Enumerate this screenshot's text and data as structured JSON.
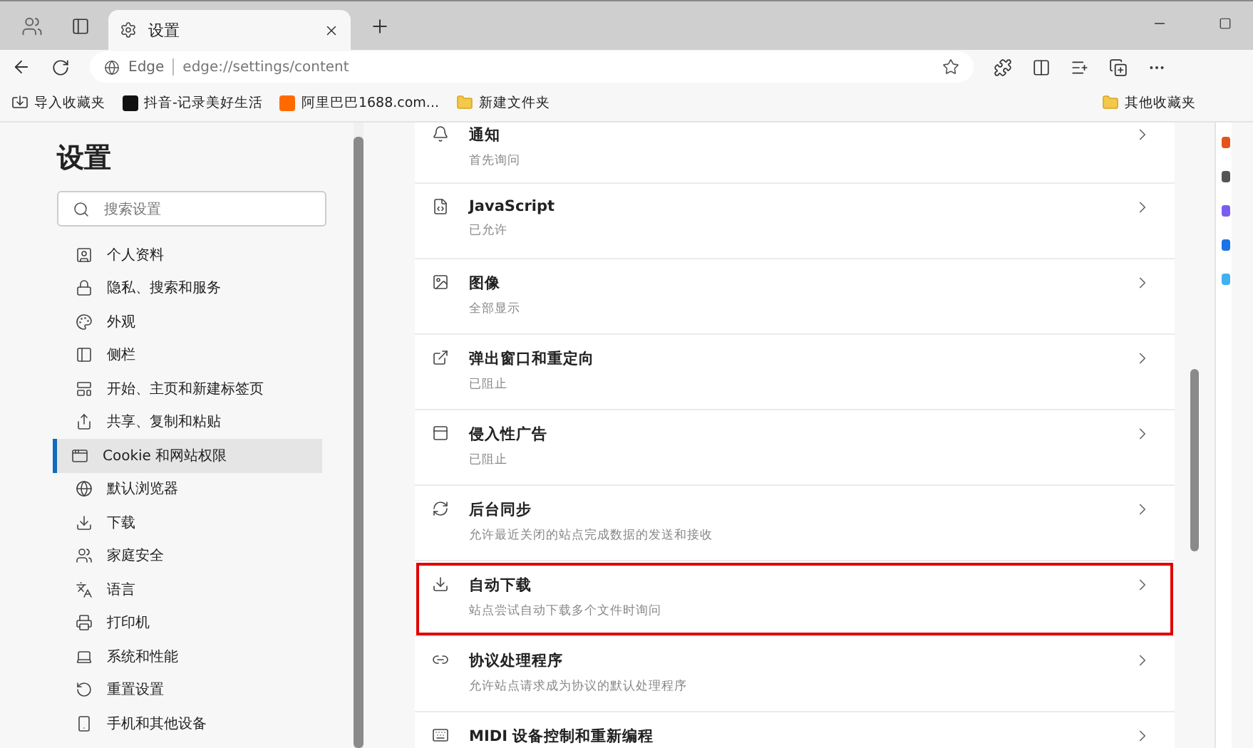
{
  "tabs": [
    {
      "title": "设置",
      "selected": true
    }
  ],
  "address_bar": {
    "site_label": "Edge",
    "url": "edge://settings/content"
  },
  "favorites": [
    {
      "kind": "import",
      "label": "导入收藏夹"
    },
    {
      "kind": "site",
      "label": "抖音-记录美好生活",
      "color": "#111111"
    },
    {
      "kind": "site",
      "label": "阿里巴巴1688.com...",
      "color": "#ff6a00"
    },
    {
      "kind": "folder",
      "label": "新建文件夹"
    }
  ],
  "other_favorites": "其他收藏夹",
  "sidebar": {
    "title": "设置",
    "search": {
      "placeholder": "搜索设置"
    },
    "items": [
      {
        "label": "个人资料",
        "selected": false
      },
      {
        "label": "隐私、搜索和服务",
        "selected": false
      },
      {
        "label": "外观",
        "selected": false
      },
      {
        "label": "侧栏",
        "selected": false
      },
      {
        "label": "开始、主页和新建标签页",
        "selected": false
      },
      {
        "label": "共享、复制和粘贴",
        "selected": false
      },
      {
        "label": "Cookie 和网站权限",
        "selected": true
      },
      {
        "label": "默认浏览器",
        "selected": false
      },
      {
        "label": "下载",
        "selected": false
      },
      {
        "label": "家庭安全",
        "selected": false
      },
      {
        "label": "语言",
        "selected": false
      },
      {
        "label": "打印机",
        "selected": false
      },
      {
        "label": "系统和性能",
        "selected": false
      },
      {
        "label": "重置设置",
        "selected": false
      },
      {
        "label": "手机和其他设备",
        "selected": false
      }
    ]
  },
  "permissions": [
    {
      "title": "通知",
      "status": "首先询问",
      "highlighted": false
    },
    {
      "title": "JavaScript",
      "status": "已允许",
      "highlighted": false
    },
    {
      "title": "图像",
      "status": "全部显示",
      "highlighted": false
    },
    {
      "title": "弹出窗口和重定向",
      "status": "已阻止",
      "highlighted": false
    },
    {
      "title": "侵入性广告",
      "status": "已阻止",
      "highlighted": false
    },
    {
      "title": "后台同步",
      "status": "允许最近关闭的站点完成数据的发送和接收",
      "highlighted": false
    },
    {
      "title": "自动下载",
      "status": "站点尝试自动下载多个文件时询问",
      "highlighted": true
    },
    {
      "title": "协议处理程序",
      "status": "允许站点请求成为协议的默认处理程序",
      "highlighted": false
    },
    {
      "title": "MIDI 设备控制和重新编程",
      "highlighted": false
    }
  ]
}
